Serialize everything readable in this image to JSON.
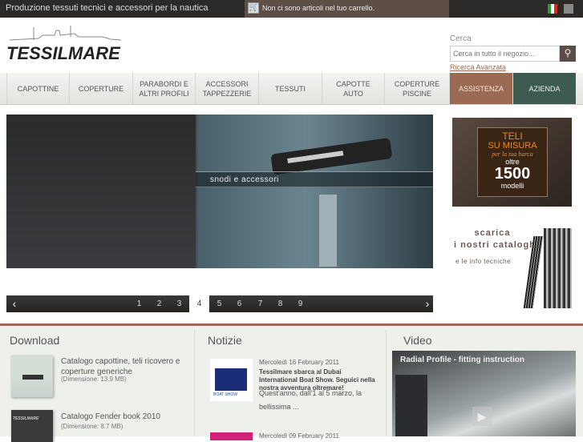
{
  "topbar": {
    "tagline": "Produzione tessuti tecnici e accessori per la nautica",
    "cart_text": "Non ci sono articoli nel tuo carrello."
  },
  "logo": {
    "text": "TESSILMARE"
  },
  "search": {
    "label": "Cerca",
    "placeholder": "Cerca in tutto il negozio...",
    "button": "⚲",
    "advanced": "Ricerca Avanzata"
  },
  "nav": [
    "CAPOTTINE",
    "COPERTURE",
    "PARABORDI E ALTRI PROFILI",
    "ACCESSORI TAPPEZZERIE",
    "TESSUTI",
    "CAPOTTE AUTO",
    "COPERTURE PISCINE",
    "ASSISTENZA",
    "AZIENDA"
  ],
  "slider": {
    "caption": "snodi e accessori",
    "pages": [
      "1",
      "2",
      "3",
      "4",
      "5",
      "6",
      "7",
      "8",
      "9"
    ],
    "active_page": "4",
    "prev": "‹",
    "next": "›"
  },
  "banner1": {
    "line1": "TELI",
    "line2": "SU MISURA",
    "line3": "per la tua barca",
    "line4": "oltre",
    "number": "1500",
    "line5": "modelli"
  },
  "banner2": {
    "line1": "scarica",
    "line2": "i nostri cataloghi",
    "line3": "e le info tecniche"
  },
  "download": {
    "title": "Download",
    "items": [
      {
        "title": "Catalogo capottine, teli ricovero e coperture generiche",
        "size": "(Dimensione: 13.9 MB)"
      },
      {
        "title": "Catalogo Fender book 2010",
        "size": "(Dimensione: 8.7 MB)",
        "thumb_text": "TESSILMARE"
      }
    ]
  },
  "news": {
    "title": "Notizie",
    "items": [
      {
        "date": "Mercoledì  16  February  2011",
        "headline": "Tessilmare sbarca al Dubai International Boat Show. Seguici nella nostra avventura oltremare!",
        "body": "Quest'anno, dall'1 al 5 marzo, la bellissima ...",
        "thumb_text": "BOAT SHOW"
      },
      {
        "date": "Mercoledì  09  February  2011"
      }
    ]
  },
  "video": {
    "title": "Video",
    "caption": "Radial Profile - fitting instruction",
    "play": "▶"
  }
}
